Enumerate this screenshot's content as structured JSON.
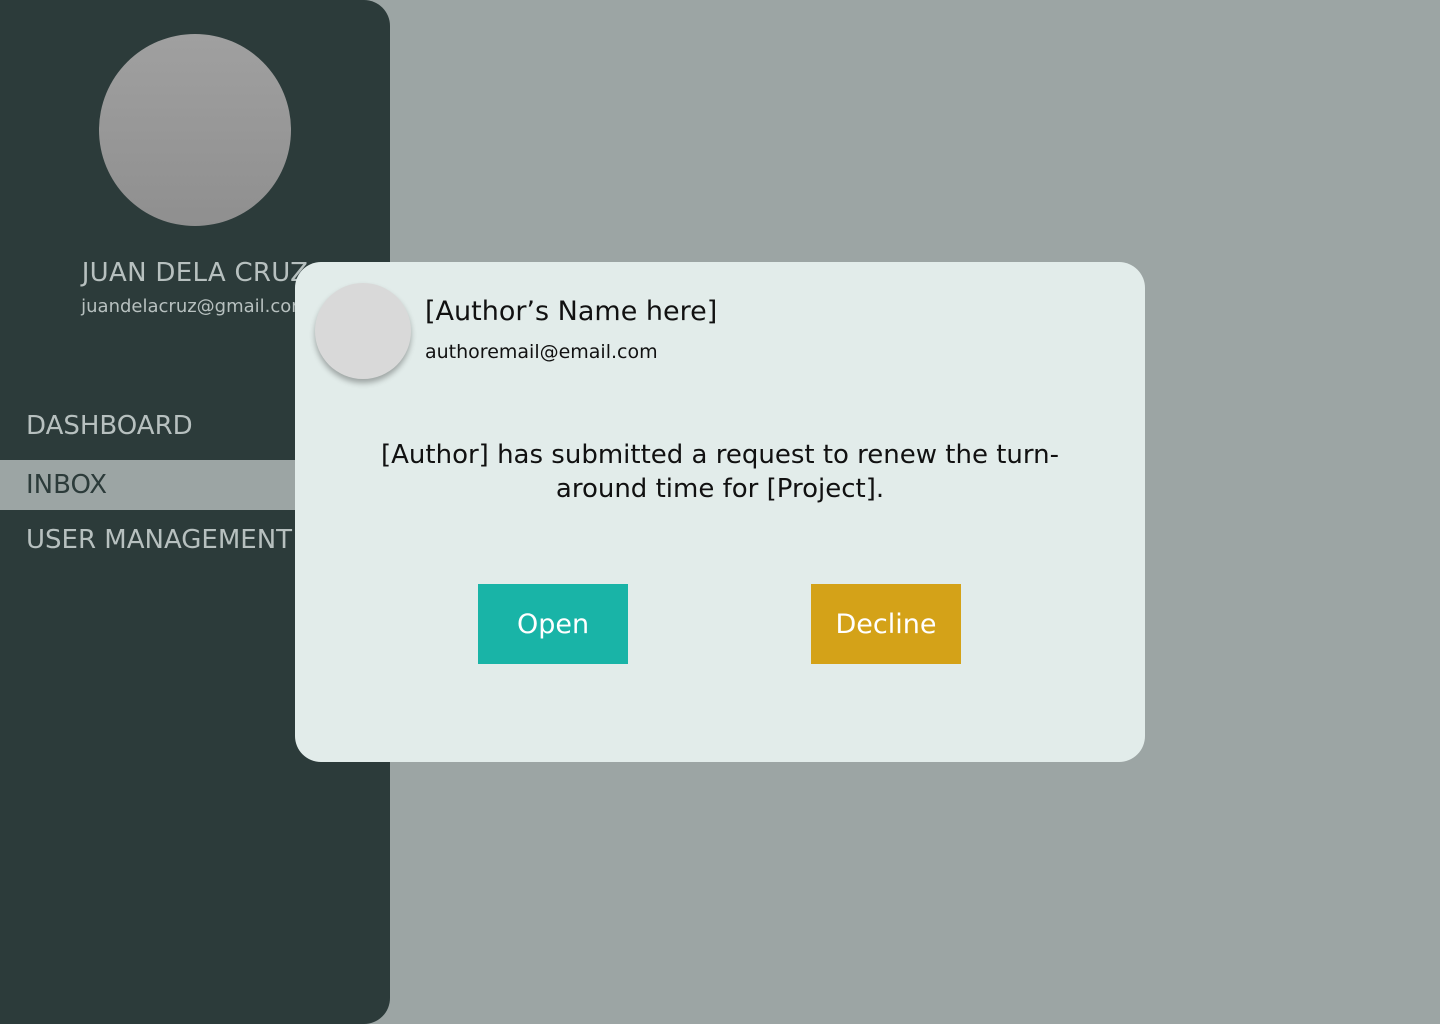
{
  "sidebar": {
    "user": {
      "name": "JUAN DELA CRUZ",
      "email": "juandelacruz@gmail.com"
    },
    "items": [
      {
        "label": "DASHBOARD",
        "active": false
      },
      {
        "label": "INBOX",
        "active": true
      },
      {
        "label": "USER MANAGEMENT",
        "active": false
      }
    ]
  },
  "modal": {
    "author_name": "[Author’s Name here]",
    "author_email": "authoremail@email.com",
    "message": "[Author] has submitted a request to renew the turn-around time for [Project].",
    "open_label": "Open",
    "decline_label": "Decline"
  },
  "colors": {
    "sidebar_bg": "#2c3b3a",
    "page_bg": "#9ca5a4",
    "modal_bg": "#e2ecea",
    "open_button": "#19b4a7",
    "decline_button": "#d4a218"
  }
}
